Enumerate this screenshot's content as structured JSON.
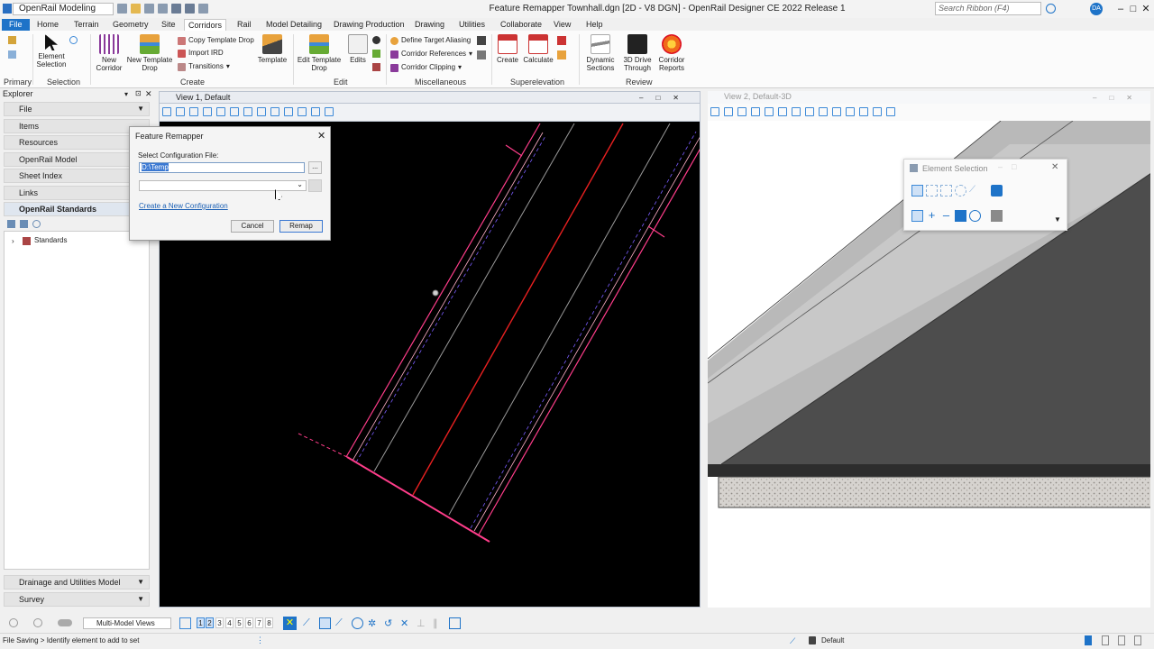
{
  "titlebar": {
    "workspace": "OpenRail Modeling",
    "title": "Feature Remapper Townhall.dgn [2D - V8 DGN] - OpenRail Designer CE 2022 Release 1",
    "search_placeholder": "Search Ribbon (F4)",
    "user_initials": "DA"
  },
  "tabs": [
    "File",
    "Home",
    "Terrain",
    "Geometry",
    "Site",
    "Corridors",
    "Rail",
    "Model Detailing",
    "Drawing Production",
    "Drawing",
    "Utilities",
    "Collaborate",
    "View",
    "Help"
  ],
  "ribbon": {
    "groups": {
      "primary": "Primary",
      "selection": "Selection",
      "create": "Create",
      "edit": "Edit",
      "misc": "Miscellaneous",
      "superelevation": "Superelevation",
      "review": "Review"
    },
    "buttons": {
      "element_selection": "Element Selection",
      "new_corridor": "New Corridor",
      "new_template_drop": "New Template Drop",
      "copy_template_drop": "Copy Template Drop",
      "import_ird": "Import IRD",
      "transitions": "Transitions",
      "template": "Template",
      "edit_template_drop": "Edit Template Drop",
      "edits": "Edits",
      "define_target_aliasing": "Define Target Aliasing",
      "corridor_references": "Corridor References",
      "corridor_clipping": "Corridor Clipping",
      "create": "Create",
      "calculate": "Calculate",
      "dynamic_sections": "Dynamic Sections",
      "drive_through": "3D Drive Through",
      "corridor_reports": "Corridor Reports"
    }
  },
  "explorer": {
    "title": "Explorer",
    "items": [
      "File",
      "Items",
      "Resources",
      "OpenRail Model",
      "Sheet Index",
      "Links",
      "OpenRail Standards"
    ],
    "tree_root": "Standards",
    "bottom_items": [
      "Drainage and Utilities Model",
      "Survey"
    ]
  },
  "views": {
    "view1_title": "View 1, Default",
    "view2_title": "View 2, Default-3D"
  },
  "dialog": {
    "title": "Feature Remapper",
    "label": "Select Configuration File:",
    "path_value": "D:\\Temp",
    "browse": "...",
    "link": "Create a New Configuration",
    "cancel": "Cancel",
    "remap": "Remap"
  },
  "element_selection": {
    "title": "Element Selection"
  },
  "bottombar": {
    "views_select": "Multi-Model Views",
    "view_numbers": [
      "1",
      "2",
      "3",
      "4",
      "5",
      "6",
      "7",
      "8"
    ]
  },
  "status": {
    "message": "File Saving > Identify element to add to set",
    "level": "Default"
  },
  "colors": {
    "accent": "#1e73c8",
    "pink_line": "#ff3d8a",
    "red_line": "#e82020"
  }
}
